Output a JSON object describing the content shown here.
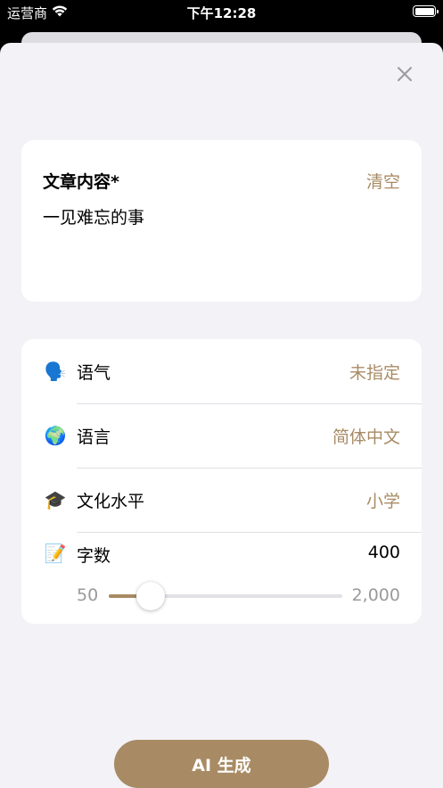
{
  "status_bar": {
    "carrier": "运营商",
    "time": "下午12:28"
  },
  "content": {
    "title": "文章内容*",
    "clear_label": "清空",
    "text": "一见难忘的事"
  },
  "settings": {
    "tone": {
      "icon": "speaking-head-emoji",
      "emoji": "🗣️",
      "label": "语气",
      "value": "未指定"
    },
    "language": {
      "icon": "globe-emoji",
      "emoji": "🌍",
      "label": "语言",
      "value": "简体中文"
    },
    "education": {
      "icon": "graduation-cap-emoji",
      "emoji": "🎓",
      "label": "文化水平",
      "value": "小学"
    },
    "word_count": {
      "icon": "memo-emoji",
      "emoji": "📝",
      "label": "字数",
      "value": "400",
      "min_label": "50",
      "max_label": "2,000",
      "min": 50,
      "max": 2000,
      "current": 400
    }
  },
  "generate_button": {
    "label": "AI 生成"
  },
  "colors": {
    "accent": "#a88b64",
    "background": "#f2f2f7",
    "card": "#ffffff"
  }
}
